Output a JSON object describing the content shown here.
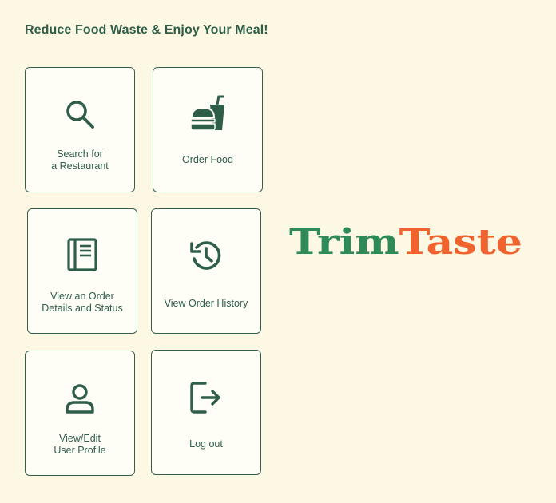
{
  "header": {
    "title": "Reduce Food Waste & Enjoy Your Meal!"
  },
  "menu": {
    "search": {
      "line1": "Search for",
      "line2": "a Restaurant",
      "icon": "search-icon"
    },
    "order_food": {
      "line1": "Order Food",
      "icon": "burger-drink-icon"
    },
    "order_details": {
      "line1": "View an Order",
      "line2": "Details and Status",
      "icon": "document-icon"
    },
    "order_history": {
      "line1": "View Order History",
      "icon": "history-icon"
    },
    "profile": {
      "line1": "View/Edit",
      "line2": "User Profile",
      "icon": "user-icon"
    },
    "logout": {
      "line1": "Log out",
      "icon": "logout-icon"
    }
  },
  "brand": {
    "part1": "Trim",
    "part2": "Taste",
    "color_part1": "#2f8a5a",
    "color_part2": "#f0622e"
  },
  "colors": {
    "background": "#fdf8e4",
    "accent": "#2f5e48"
  }
}
